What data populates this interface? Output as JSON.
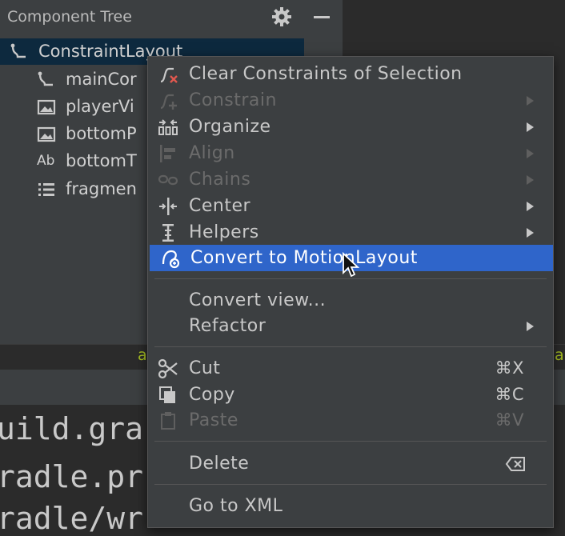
{
  "panel": {
    "title": "Component Tree",
    "settings_icon": "gear-icon",
    "minimize_icon": "minimize-icon"
  },
  "tree": {
    "items": [
      {
        "label": "ConstraintLayout",
        "icon": "constraint-layout-icon"
      },
      {
        "label": "mainCor",
        "icon": "constraint-layout-icon"
      },
      {
        "label": "playerVi",
        "icon": "image-icon"
      },
      {
        "label": "bottomP",
        "icon": "image-icon"
      },
      {
        "label": "bottomT",
        "icon": "text-icon",
        "icon_text": "Ab"
      },
      {
        "label": "fragmen",
        "icon": "list-icon"
      }
    ]
  },
  "strip": {
    "left_char": "a",
    "right_char": "a"
  },
  "editor": {
    "lines": [
      "uild.gra",
      "radle.pr",
      "radle/wr"
    ]
  },
  "menu": {
    "items": [
      {
        "label": "Clear Constraints of Selection",
        "icon": "clear-constraints-icon",
        "enabled": true,
        "submenu": false
      },
      {
        "label": "Constrain",
        "icon": "constrain-icon",
        "enabled": false,
        "submenu": true
      },
      {
        "label": "Organize",
        "icon": "organize-icon",
        "enabled": true,
        "submenu": true
      },
      {
        "label": "Align",
        "icon": "align-icon",
        "enabled": false,
        "submenu": true
      },
      {
        "label": "Chains",
        "icon": "chains-icon",
        "enabled": false,
        "submenu": true
      },
      {
        "label": "Center",
        "icon": "center-icon",
        "enabled": true,
        "submenu": true
      },
      {
        "label": "Helpers",
        "icon": "helpers-icon",
        "enabled": true,
        "submenu": true
      },
      {
        "label": "Convert to MotionLayout",
        "icon": "motion-layout-icon",
        "enabled": true,
        "submenu": false,
        "highlighted": true
      },
      {
        "label": "Convert view...",
        "enabled": true,
        "submenu": false
      },
      {
        "label": "Refactor",
        "enabled": true,
        "submenu": true
      },
      {
        "label": "Cut",
        "icon": "scissors-icon",
        "shortcut": "⌘X",
        "enabled": true
      },
      {
        "label": "Copy",
        "icon": "copy-icon",
        "shortcut": "⌘C",
        "enabled": true
      },
      {
        "label": "Paste",
        "icon": "paste-icon",
        "shortcut": "⌘V",
        "enabled": false
      },
      {
        "label": "Delete",
        "icon": "delete-key-icon",
        "enabled": true
      },
      {
        "label": "Go to XML",
        "enabled": true
      }
    ]
  },
  "colors": {
    "highlight": "#2f65ca",
    "panel_bg": "#3c3f41",
    "editor_bg": "#2b2b2b",
    "selected_row": "#0d293e"
  }
}
